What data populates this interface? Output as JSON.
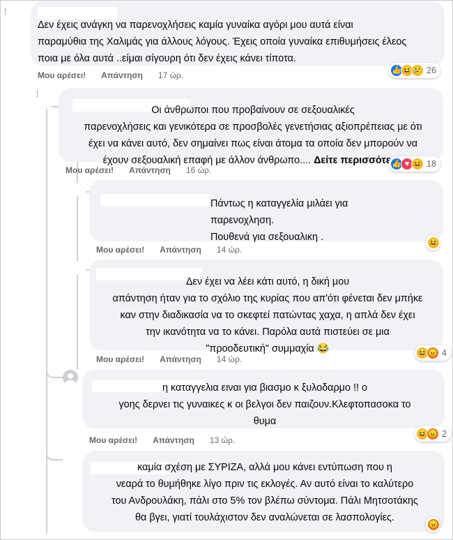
{
  "comments": [
    {
      "text": "Δεν έχεις ανάγκη να παρενοχλήσεις καμία γυναίκα αγόρι μου αυτά είναι\nπαραμύθια της Χαλιμάς για άλλους λόγους. Έχεις οποία γυναίκα επιθυμήσεις έλεος\nποια με όλα αυτά ..είμαι σίγουρη ότι δεν έχεις κάνει τίποτα.",
      "like_label": "Μου αρέσει!",
      "reply_label": "Απάντηση",
      "time": "17 ώρ.",
      "reactions": [
        "like-icon",
        "haha-icon",
        "sad-icon"
      ],
      "reaction_count": "26"
    },
    {
      "text": "Οι άνθρωποι που προβαίνουν σε σεξουαλικές\nπαρενοχλήσεις και γενικότερα σε προσβολές γενετήσιας αξιοπρέπειας με ότι\nέχει να κάνει αυτό, δεν σημαίνει πως είναι άτομα τα οποία δεν μπορούν να\nέχουν σεξουαλική επαφή με άλλον άνθρωπο....",
      "see_more": "Δείτε περισσότερα",
      "like_label": "Μου αρέσει!",
      "reply_label": "Απάντηση",
      "time": "16 ώρ.",
      "reactions": [
        "like-icon",
        "love-icon",
        "haha-icon"
      ],
      "reaction_count": "18"
    },
    {
      "text": "Πάντως η καταγγελία μιλάει για\nπαρενοχληση.\nΠουθενά για σεξουαλικη .",
      "like_label": "Μου αρέσει!",
      "reply_label": "Απάντηση",
      "time": "14 ώρ.",
      "reactions": [
        "haha-icon"
      ],
      "reaction_count": ""
    },
    {
      "text": "Δεν έχει να λέει κάτι αυτό, η δική μου\nαπάντηση ήταν για το σχόλιο της κυρίας που απ'ότι φένεται δεν μπήκε\nκαν στην διαδικασία να το σκεφτεί πατώντας χαχα, η απλά δεν έχει\nτην ικανότητα να το κάνει. Παρόλα αυτά πιστεύει σε μια\n\"προοδευτική\" συμμαχία 😂",
      "like_label": "Μου αρέσει!",
      "reply_label": "Απάντηση",
      "time": "14 ώρ.",
      "reactions": [
        "haha-icon",
        "angry-icon"
      ],
      "reaction_count": "4"
    },
    {
      "text": "η καταγγελια ειναι για βιασμο κ ξυλοδαρμο !! ο\nγοης δερνει τις γυναικες κ οι βελγοι δεν παιζουν.Κλεφτοπασοκα το\nθυμα",
      "like_label": "Μου αρέσει!",
      "reply_label": "Απάντηση",
      "time": "13 ώρ.",
      "reactions": [
        "haha-icon",
        "angry-icon"
      ],
      "reaction_count": "2"
    },
    {
      "text": "καμία σχέση με ΣΥΡΙΖΑ, αλλά μου κάνει εντύπωση που η\nνεαρά το θυμήθηκε λίγο πριν τις εκλογές. Αν αυτό είναι το καλύτερο\nτου Ανδρουλάκη, πάλι στο 5% τον βλέπω σύντομα. Πάλι Μητσοτάκης\nθα βγει, γιατί τουλάχιστον δεν αναλώνεται σε λασπολογίες.",
      "reactions": [
        "angry-icon"
      ],
      "reaction_count": ""
    }
  ]
}
